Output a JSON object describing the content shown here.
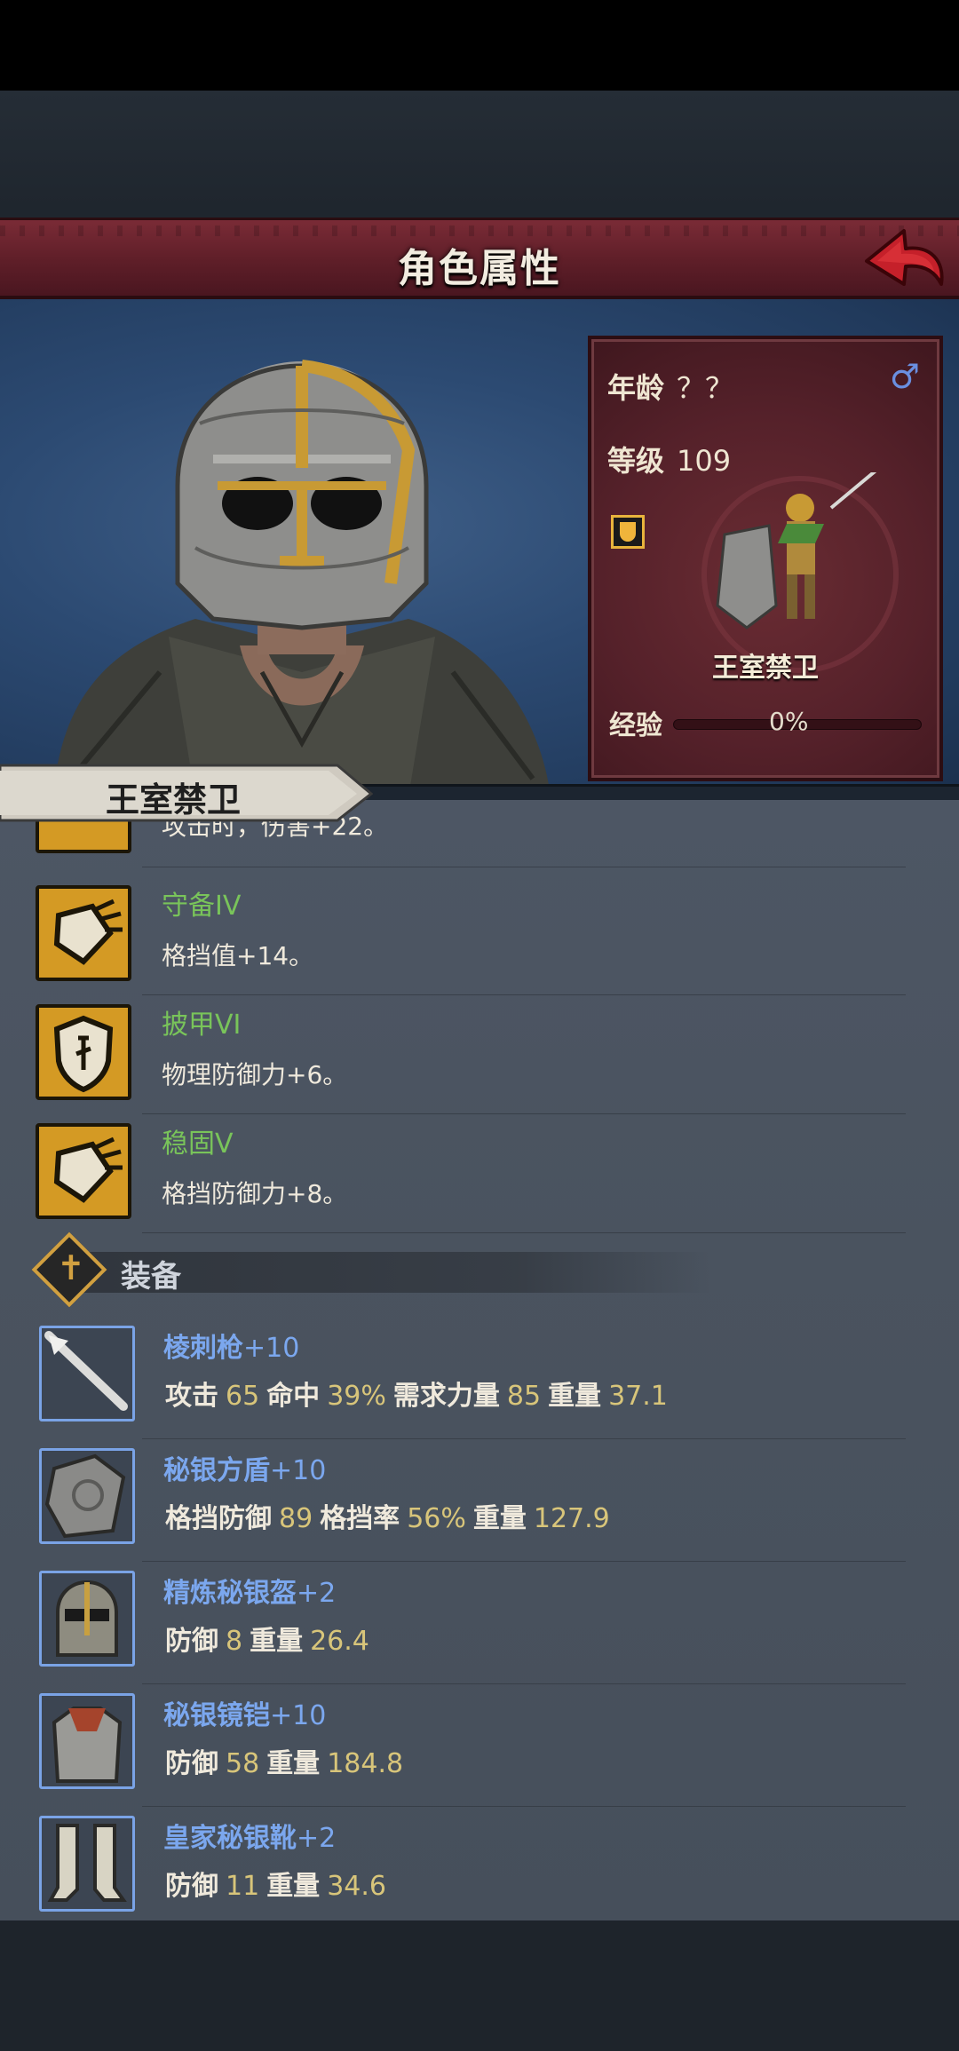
{
  "header": {
    "title": "角色属性"
  },
  "info": {
    "age_label": "年龄",
    "age_value": "？？",
    "gender_symbol": "♂",
    "level_label": "等级",
    "level_value": "109",
    "unit_name": "王室禁卫",
    "xp_label": "经验",
    "xp_value": "0%",
    "xp_fraction": 0
  },
  "name_banner": "王室禁卫",
  "skills": [
    {
      "name": "",
      "desc": "攻击时，伤害+22。",
      "icon": "crossed-weapons-icon"
    },
    {
      "name": "守备IV",
      "desc": "格挡值+14。",
      "icon": "shield-block-icon"
    },
    {
      "name": "披甲VI",
      "desc": "物理防御力+6。",
      "icon": "shield-icon"
    },
    {
      "name": "稳固V",
      "desc": "格挡防御力+8。",
      "icon": "shield-block-icon"
    }
  ],
  "equipment_section": {
    "title": "装备",
    "icon": "cross-icon"
  },
  "equipment": [
    {
      "name": "棱刺枪",
      "plus": "+10",
      "icon": "spear-icon",
      "stats": [
        [
          "攻击",
          "65"
        ],
        [
          "命中",
          "39%"
        ],
        [
          "需求力量",
          "85"
        ],
        [
          "重量",
          "37.1"
        ]
      ]
    },
    {
      "name": "秘银方盾",
      "plus": "+10",
      "icon": "tower-shield-icon",
      "stats": [
        [
          "格挡防御",
          "89"
        ],
        [
          "格挡率",
          "56%"
        ],
        [
          "重量",
          "127.9"
        ]
      ]
    },
    {
      "name": "精炼秘银盔",
      "plus": "+2",
      "icon": "helmet-icon",
      "stats": [
        [
          "防御",
          "8"
        ],
        [
          "重量",
          "26.4"
        ]
      ]
    },
    {
      "name": "秘银镜铠",
      "plus": "+10",
      "icon": "armor-icon",
      "stats": [
        [
          "防御",
          "58"
        ],
        [
          "重量",
          "184.8"
        ]
      ]
    },
    {
      "name": "皇家秘银靴",
      "plus": "+2",
      "icon": "boots-icon",
      "stats": [
        [
          "防御",
          "11"
        ],
        [
          "重量",
          "34.6"
        ]
      ]
    }
  ],
  "colors": {
    "header": "#5e1e28",
    "skill_name": "#79c45a",
    "equip_name": "#7ba7ee",
    "stat_value": "#d8c57a"
  }
}
